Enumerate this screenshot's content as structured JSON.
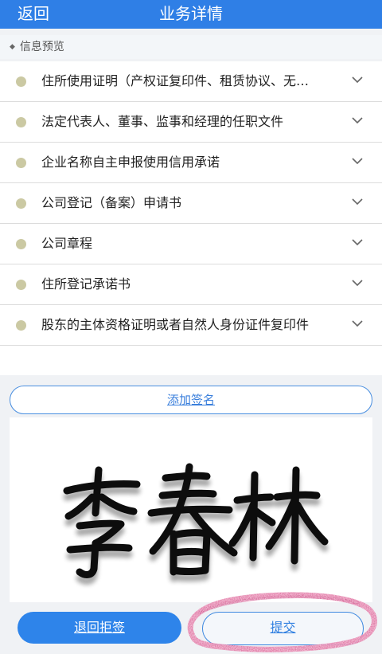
{
  "header": {
    "back_label": "返回",
    "title": "业务详情"
  },
  "section": {
    "title": "信息预览"
  },
  "documents": [
    "住所使用证明（产权证复印件、租赁协议、无偿使用证明等）",
    "法定代表人、董事、监事和经理的任职文件",
    "企业名称自主申报使用信用承诺",
    "公司登记（备案）申请书",
    "公司章程",
    "住所登记承诺书",
    "股东的主体资格证明或者自然人身份证件复印件"
  ],
  "signature": {
    "add_label": "添加签名",
    "text": "李春林"
  },
  "actions": {
    "reject_label": "退回拒签",
    "submit_label": "提交"
  },
  "colors": {
    "header_bg": "#2f7fe6",
    "dot": "#cbc9a3",
    "highlight": "#e06fa0"
  }
}
